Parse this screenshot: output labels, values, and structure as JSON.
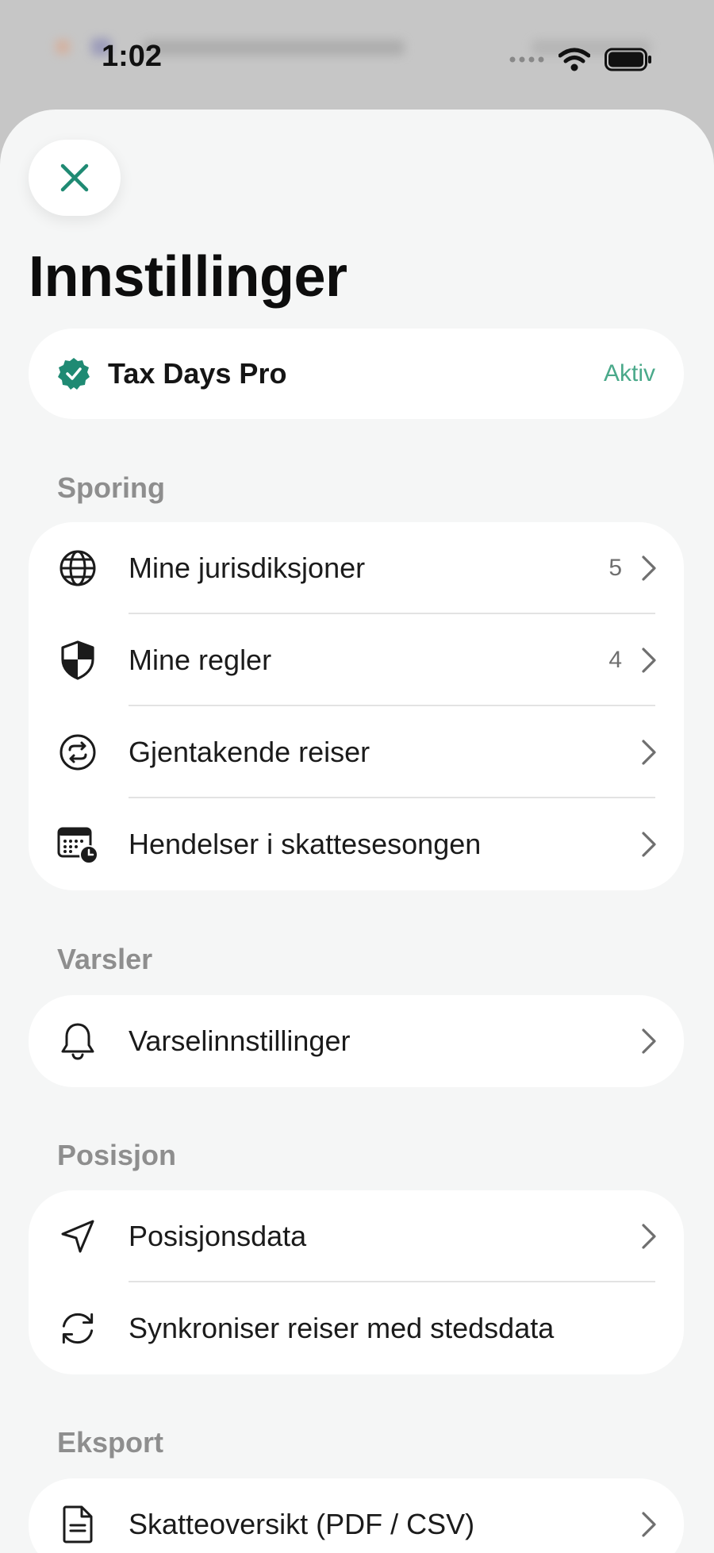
{
  "status_bar": {
    "time": "1:02"
  },
  "sheet": {
    "title": "Innstillinger",
    "close_icon": "close-icon",
    "pro": {
      "name": "Tax Days Pro",
      "status": "Aktiv",
      "icon": "verified-badge-icon"
    },
    "sections": [
      {
        "label": "Sporing",
        "items": [
          {
            "label": "Mine jurisdiksjoner",
            "count": "5",
            "icon": "globe-icon"
          },
          {
            "label": "Mine regler",
            "count": "4",
            "icon": "shield-icon"
          },
          {
            "label": "Gjentakende reiser",
            "count": "",
            "icon": "repeat-icon"
          },
          {
            "label": "Hendelser i skattesesongen",
            "count": "",
            "icon": "calendar-clock-icon"
          }
        ]
      },
      {
        "label": "Varsler",
        "items": [
          {
            "label": "Varselinnstillinger",
            "count": "",
            "icon": "bell-icon"
          }
        ]
      },
      {
        "label": "Posisjon",
        "items": [
          {
            "label": "Posisjonsdata",
            "count": "",
            "icon": "location-arrow-icon"
          },
          {
            "label": "Synkroniser reiser med stedsdata",
            "count": "",
            "icon": "sync-icon"
          }
        ]
      },
      {
        "label": "Eksport",
        "items": [
          {
            "label": "Skatteoversikt (PDF / CSV)",
            "count": "",
            "icon": "document-icon"
          }
        ]
      }
    ]
  },
  "colors": {
    "accent": "#1f8a73",
    "pro_status": "#4aa98a",
    "sheet_bg": "#f5f6f6"
  }
}
